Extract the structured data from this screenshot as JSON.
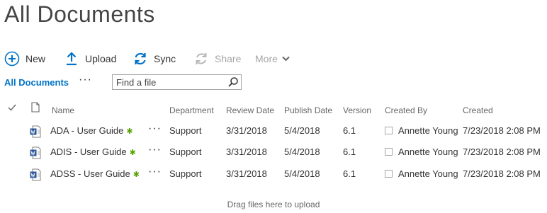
{
  "page_title": "All Documents",
  "commands": {
    "new": "New",
    "upload": "Upload",
    "sync": "Sync",
    "share": "Share",
    "more": "More"
  },
  "view": {
    "label": "All Documents",
    "more": "···"
  },
  "search": {
    "placeholder": "Find a file"
  },
  "columns": {
    "name": "Name",
    "department": "Department",
    "review_date": "Review Date",
    "publish_date": "Publish Date",
    "version": "Version",
    "created_by": "Created By",
    "created": "Created"
  },
  "rows": [
    {
      "name": "ADA - User Guide",
      "department": "Support",
      "review_date": "3/31/2018",
      "publish_date": "5/4/2018",
      "version": "6.1",
      "created_by": "Annette Young",
      "created": "7/23/2018 2:08 PM"
    },
    {
      "name": "ADIS - User Guide",
      "department": "Support",
      "review_date": "3/31/2018",
      "publish_date": "5/4/2018",
      "version": "6.1",
      "created_by": "Annette Young",
      "created": "7/23/2018 2:08 PM"
    },
    {
      "name": "ADSS - User Guide",
      "department": "Support",
      "review_date": "3/31/2018",
      "publish_date": "5/4/2018",
      "version": "6.1",
      "created_by": "Annette Young",
      "created": "7/23/2018 2:08 PM"
    }
  ],
  "row_more": "···",
  "new_badge": "✱",
  "drop_hint": "Drag files here to upload",
  "colors": {
    "accent": "#0072c6",
    "new_badge": "#57a300",
    "disabled": "#a6a6a6",
    "word": "#2b579a"
  },
  "icons": {
    "new": "plus-circle-icon",
    "upload": "upload-arrow-icon",
    "sync": "sync-icon",
    "share": "share-icon",
    "more": "chevron-down-icon",
    "search": "search-icon",
    "file": "word-document-icon",
    "select_all": "checkmark-icon",
    "doc_type": "document-icon"
  }
}
